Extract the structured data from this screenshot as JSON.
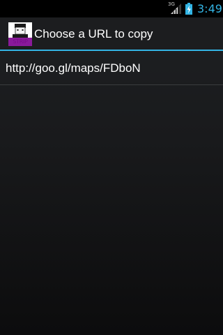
{
  "status_bar": {
    "network_type": "3G",
    "signal_icon": "signal-strength-icon",
    "battery_icon": "battery-charging-icon",
    "time": "3:49",
    "time_color": "#33b5e5"
  },
  "action_bar": {
    "app_icon": "app-logo-icon",
    "app_icon_text": "STRIP",
    "title": "Choose a URL to copy",
    "accent_color": "#33b5e5"
  },
  "url_list": {
    "items": [
      {
        "url": "http://goo.gl/maps/FDboN"
      }
    ]
  }
}
